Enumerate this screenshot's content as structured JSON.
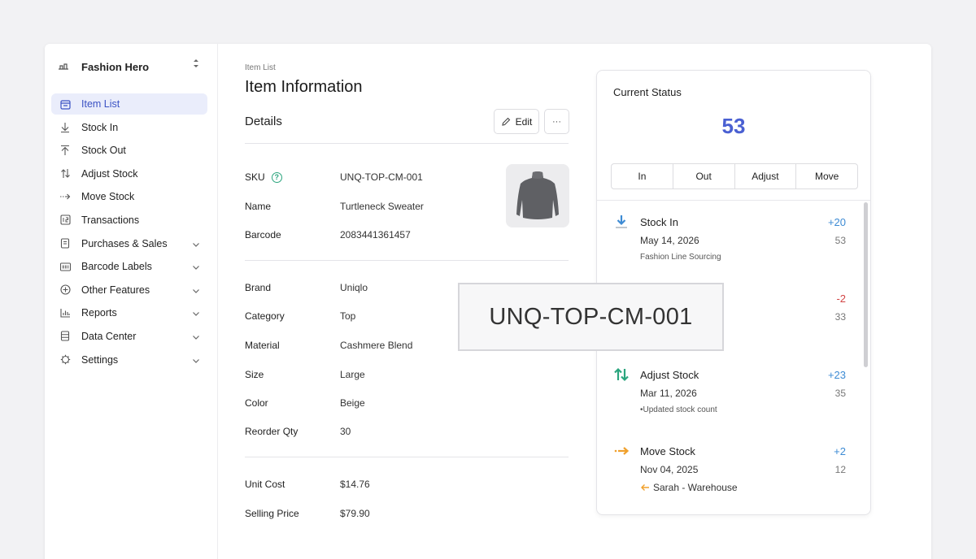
{
  "sidebar": {
    "brand": "Fashion Hero",
    "items": [
      {
        "label": "Item List",
        "icon": "item-list-icon",
        "active": true,
        "expandable": false
      },
      {
        "label": "Stock In",
        "icon": "arrow-down-icon",
        "active": false,
        "expandable": false
      },
      {
        "label": "Stock Out",
        "icon": "arrow-up-icon",
        "active": false,
        "expandable": false
      },
      {
        "label": "Adjust Stock",
        "icon": "adjust-icon",
        "active": false,
        "expandable": false
      },
      {
        "label": "Move Stock",
        "icon": "arrow-right-icon",
        "active": false,
        "expandable": false
      },
      {
        "label": "Transactions",
        "icon": "transactions-icon",
        "active": false,
        "expandable": false
      },
      {
        "label": "Purchases & Sales",
        "icon": "document-icon",
        "active": false,
        "expandable": true
      },
      {
        "label": "Barcode Labels",
        "icon": "barcode-icon",
        "active": false,
        "expandable": true
      },
      {
        "label": "Other Features",
        "icon": "plus-circle-icon",
        "active": false,
        "expandable": true
      },
      {
        "label": "Reports",
        "icon": "bar-chart-icon",
        "active": false,
        "expandable": true
      },
      {
        "label": "Data Center",
        "icon": "database-icon",
        "active": false,
        "expandable": true
      },
      {
        "label": "Settings",
        "icon": "gear-icon",
        "active": false,
        "expandable": true
      }
    ]
  },
  "main": {
    "breadcrumb": "Item List",
    "title": "Item Information",
    "section_title": "Details",
    "edit_label": "Edit",
    "more_label": "···",
    "fields_basic": [
      {
        "key": "SKU",
        "value": "UNQ-TOP-CM-001",
        "help": true
      },
      {
        "key": "Name",
        "value": "Turtleneck Sweater"
      },
      {
        "key": "Barcode",
        "value": "2083441361457"
      }
    ],
    "fields_attrs": [
      {
        "key": "Brand",
        "value": "Uniqlo"
      },
      {
        "key": "Category",
        "value": "Top"
      },
      {
        "key": "Material",
        "value": "Cashmere Blend"
      },
      {
        "key": "Size",
        "value": "Large"
      },
      {
        "key": "Color",
        "value": "Beige"
      },
      {
        "key": "Reorder Qty",
        "value": "30"
      }
    ],
    "fields_price": [
      {
        "key": "Unit Cost",
        "value": "$14.76"
      },
      {
        "key": "Selling Price",
        "value": "$79.90"
      }
    ]
  },
  "status": {
    "title": "Current Status",
    "count": "53",
    "tabs": [
      "In",
      "Out",
      "Adjust",
      "Move"
    ],
    "transactions": [
      {
        "type": "Stock In",
        "date": "May 14, 2026",
        "note": "Fashion Line Sourcing",
        "delta": "+20",
        "balance": "53",
        "kind": "in"
      },
      {
        "type": "",
        "date": "",
        "note": "",
        "delta": "-2",
        "balance": "33",
        "kind": "out"
      },
      {
        "type": "Adjust Stock",
        "date": "Mar 11, 2026",
        "note": "•Updated stock count",
        "delta": "+23",
        "balance": "35",
        "kind": "adjust"
      },
      {
        "type": "Move Stock",
        "date": "Nov 04, 2025",
        "note": "Sarah - Warehouse",
        "delta": "+2",
        "balance": "12",
        "kind": "move"
      }
    ]
  },
  "zoom": {
    "text": "UNQ-TOP-CM-001"
  },
  "colors": {
    "accent": "#4a60d2",
    "positive": "#3d8bd4",
    "negative": "#d24545",
    "help": "#2ba57e",
    "move": "#f0a02c",
    "adjust": "#2ba57e"
  }
}
